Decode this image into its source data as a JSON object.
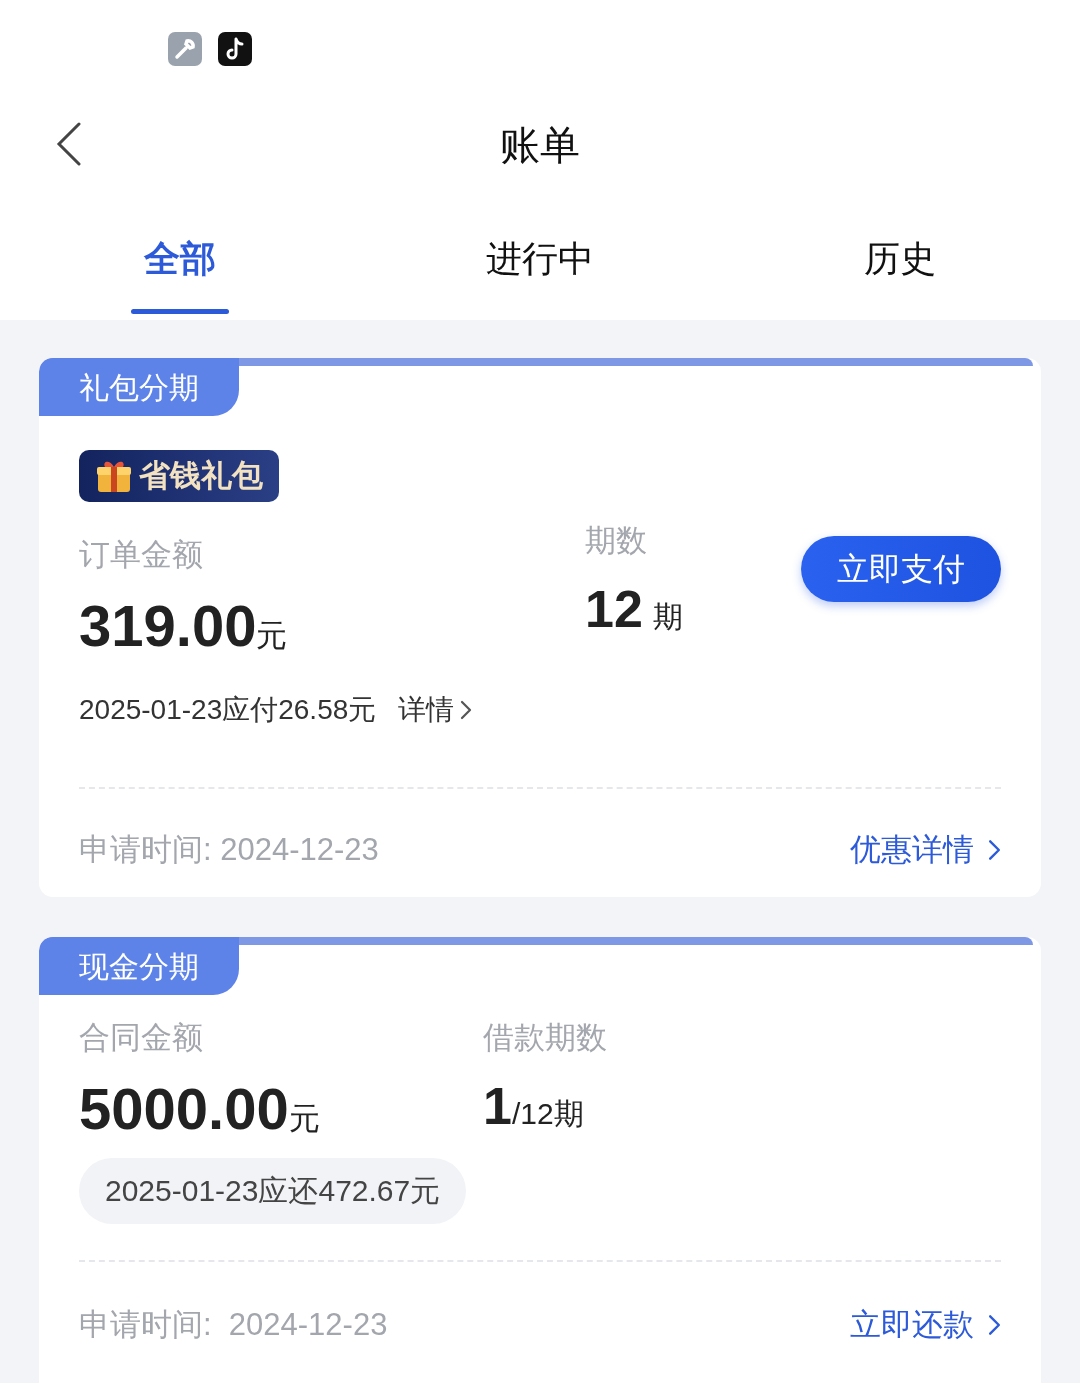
{
  "header": {
    "title": "账单"
  },
  "tabs": [
    {
      "label": "全部",
      "selected": true
    },
    {
      "label": "进行中",
      "selected": false
    },
    {
      "label": "历史",
      "selected": false
    }
  ],
  "cards": [
    {
      "kind": "gift",
      "tag": "礼包分期",
      "badge": "省钱礼包",
      "fields": [
        {
          "label": "订单金额",
          "value": "319.00",
          "unit": "元"
        },
        {
          "label": "期数",
          "value": "12",
          "unit": "期"
        }
      ],
      "due": "2025-01-23应付26.58元",
      "due_link": "详情",
      "button": "立即支付",
      "apply_time": "申请时间: 2024-12-23",
      "footer_link": "优惠详情"
    },
    {
      "kind": "cash",
      "tag": "现金分期",
      "fields": [
        {
          "label": "合同金额",
          "value": "5000.00",
          "unit": "元"
        },
        {
          "label": "借款期数",
          "value": "1",
          "unit": "/12期"
        }
      ],
      "due": "2025-01-23应还472.67元",
      "apply_time": "申请时间:  2024-12-23",
      "footer_link": "立即还款"
    }
  ]
}
